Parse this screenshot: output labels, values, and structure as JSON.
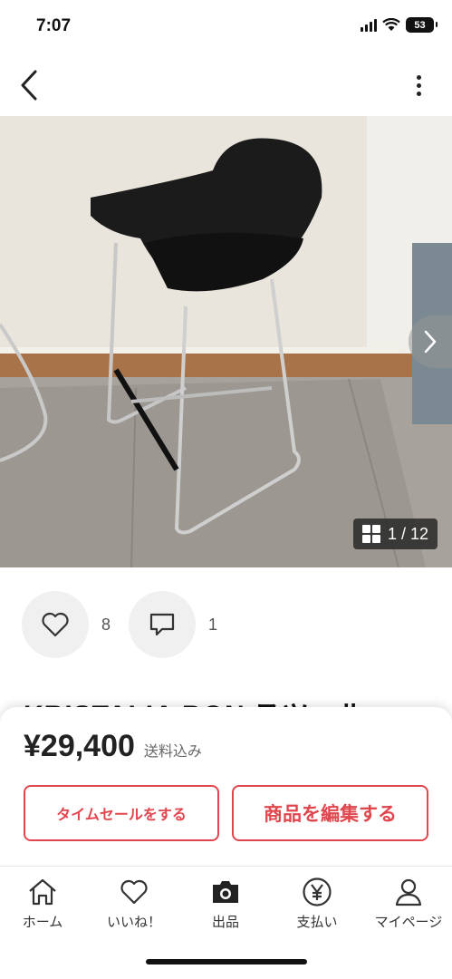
{
  "status_bar": {
    "time": "7:07",
    "battery": "53"
  },
  "nav": {
    "back_icon": "chevron-left-icon",
    "more_icon": "more-vertical-icon"
  },
  "photo": {
    "page_counter": "1 / 12",
    "current_index": 1,
    "total": 12
  },
  "actions": {
    "like_count": "8",
    "comment_count": "1"
  },
  "item": {
    "title": "KRISTALIA BON スツール"
  },
  "purchase": {
    "price": "¥29,400",
    "shipping_note": "送料込み",
    "timesale_button": "タイムセールをする",
    "edit_button": "商品を編集する",
    "accent_color": "#e0464d"
  },
  "tabbar": {
    "items": [
      {
        "label": "ホーム",
        "icon": "home-icon"
      },
      {
        "label": "いいね！",
        "icon": "heart-icon"
      },
      {
        "label": "出品",
        "icon": "camera-icon"
      },
      {
        "label": "支払い",
        "icon": "yen-icon"
      },
      {
        "label": "マイページ",
        "icon": "person-icon"
      }
    ]
  }
}
